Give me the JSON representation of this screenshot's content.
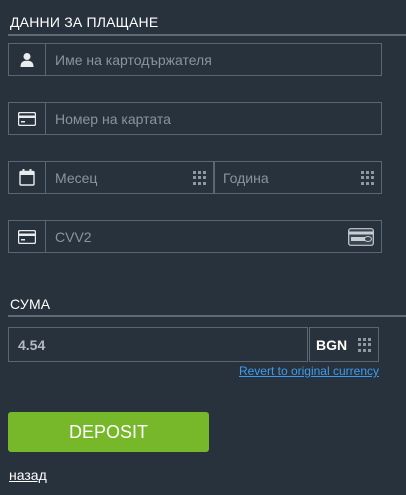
{
  "payment": {
    "title": "ДАННИ ЗА ПЛАЩАНЕ",
    "cardholder_placeholder": "Име на картодържателя",
    "card_number_placeholder": "Номер на картата",
    "month_placeholder": "Месец",
    "year_placeholder": "Година",
    "cvv_placeholder": "CVV2"
  },
  "amount": {
    "title": "СУМА",
    "value": "4.54",
    "currency": "BGN",
    "revert_link": "Revert to original currency"
  },
  "actions": {
    "deposit_label": "DEPOSIT",
    "back_label": "назад"
  },
  "colors": {
    "background": "#28323d",
    "border": "#5a6673",
    "accent_green": "#76b82a",
    "link_blue": "#3d9cf0"
  }
}
